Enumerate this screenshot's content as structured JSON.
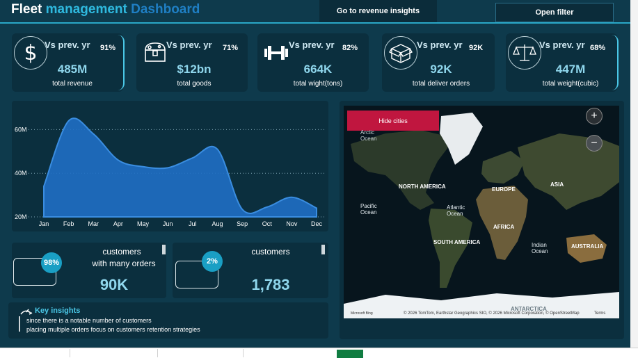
{
  "header": {
    "title_word1": "Fleet",
    "title_word2": "management",
    "title_word3": "Dashboard",
    "revenue_button": "Go to revenue insights",
    "filter_button": "Open filter"
  },
  "kpis": [
    {
      "icon": "dollar-icon",
      "vs": "Vs prev. yr",
      "pct": "91%",
      "value": "485M",
      "label": "total revenue"
    },
    {
      "icon": "treasure-chest-icon",
      "vs": "Vs prev. yr",
      "pct": "71%",
      "value": "$12bn",
      "label": "total goods"
    },
    {
      "icon": "dumbbell-icon",
      "vs": "Vs prev. yr",
      "pct": "82%",
      "value": "664K",
      "label": "total wight(tons)"
    },
    {
      "icon": "box-icon",
      "vs": "Vs prev. yr",
      "pct": "92K",
      "value": "92K",
      "label": "total deliver orders"
    },
    {
      "icon": "scale-icon",
      "vs": "Vs prev. yr",
      "pct": "68%",
      "value": "447M",
      "label": "total  weight(cubic)"
    }
  ],
  "chart_data": {
    "type": "area",
    "categories": [
      "Jan",
      "Feb",
      "Mar",
      "Apr",
      "May",
      "Jun",
      "Jul",
      "Aug",
      "Sep",
      "Oct",
      "Nov",
      "Dec"
    ],
    "values": [
      34,
      64,
      58,
      46,
      43,
      42.5,
      47,
      51,
      23.5,
      24.5,
      29,
      24
    ],
    "ylim": [
      20,
      70
    ],
    "yticks": [
      20,
      40,
      60
    ],
    "ytick_labels": [
      "20M",
      "40M",
      "60M"
    ],
    "color": "#1f6fc4",
    "grid": true
  },
  "customers": [
    {
      "pct": "98%",
      "title_line1": "customers",
      "title_line2": "with many orders",
      "value": "90K"
    },
    {
      "pct": "2%",
      "title_line1": "customers",
      "title_line2": "",
      "value": "1,783"
    }
  ],
  "insights": {
    "title": "Key insights",
    "line1": "since there is a notable number of customers",
    "line2": "placing multiple orders focus on customers retention strategies"
  },
  "map": {
    "hide_button": "Hide cities",
    "zoom_in": "+",
    "zoom_out": "−",
    "labels": {
      "arctic": "Arctic Ocean",
      "arctic1": "Arctic",
      "arctic2": "Ocean",
      "north_america": "NORTH AMERICA",
      "europe": "EUROPE",
      "asia": "ASIA",
      "pacific1": "Pacific",
      "pacific2": "Ocean",
      "atlantic1": "Atlantic",
      "atlantic2": "Ocean",
      "africa": "AFRICA",
      "south_america": "SOUTH AMERICA",
      "indian1": "Indian",
      "indian2": "Ocean",
      "australia": "AUSTRALIA",
      "antarctica": "ANTARCTICA"
    },
    "attribution_left": "Microsoft Bing",
    "attribution": "© 2026 TomTom, Earthstar Geographics SIO, © 2026 Microsoft Corporation, © OpenStreetMap",
    "terms": "Terms"
  },
  "colors": {
    "background": "#0e3a4c",
    "panel": "#0b2f3e",
    "accent": "#2fb9df",
    "badge": "#1a9fc4",
    "hide_button": "#c0163f",
    "area_fill": "#1f6fc4"
  }
}
